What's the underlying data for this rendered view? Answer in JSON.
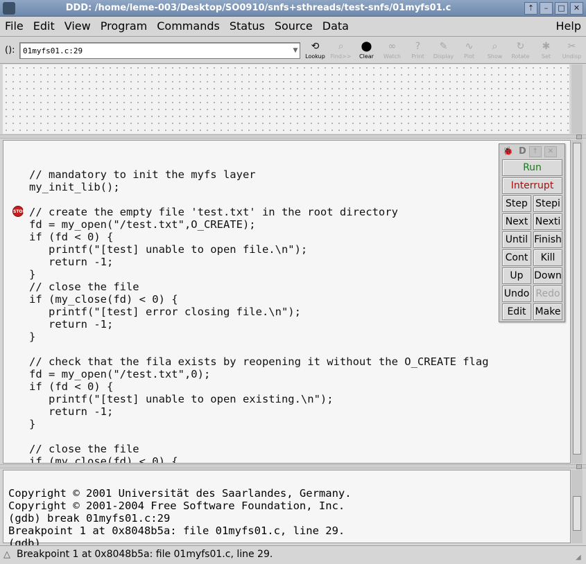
{
  "window": {
    "title": "DDD: /home/leme-003/Desktop/SO0910/snfs+sthreads/test-snfs/01myfs01.c",
    "buttons": [
      "⇡",
      "–",
      "□",
      "✕"
    ]
  },
  "menu": {
    "items": [
      "File",
      "Edit",
      "View",
      "Program",
      "Commands",
      "Status",
      "Source",
      "Data"
    ],
    "help": "Help"
  },
  "toolbar": {
    "arg_label": "():",
    "arg_value": "01myfs01.c:29",
    "tools": [
      {
        "label": "Lookup",
        "icon": "lookup-icon",
        "enabled": true
      },
      {
        "label": "Find>>",
        "icon": "find-icon",
        "enabled": false
      },
      {
        "label": "Clear",
        "icon": "clear-icon",
        "enabled": true
      },
      {
        "label": "Watch",
        "icon": "watch-icon",
        "enabled": false
      },
      {
        "label": "Print",
        "icon": "print-icon",
        "enabled": false
      },
      {
        "label": "Display",
        "icon": "display-icon",
        "enabled": false
      },
      {
        "label": "Plot",
        "icon": "plot-icon",
        "enabled": false
      },
      {
        "label": "Show",
        "icon": "show-icon",
        "enabled": false
      },
      {
        "label": "Rotate",
        "icon": "rotate-icon",
        "enabled": false
      },
      {
        "label": "Set",
        "icon": "set-icon",
        "enabled": false
      },
      {
        "label": "Undisp",
        "icon": "undisp-icon",
        "enabled": false
      }
    ]
  },
  "source": {
    "breakpoint_icon_text": "STOP",
    "lines": [
      "// mandatory to init the myfs layer",
      "my_init_lib();",
      "",
      "// create the empty file 'test.txt' in the root directory",
      "fd = my_open(\"/test.txt\",O_CREATE);",
      "if (fd < 0) {",
      "   printf(\"[test] unable to open file.\\n\");",
      "   return -1;",
      "}",
      "// close the file",
      "if (my_close(fd) < 0) {",
      "   printf(\"[test] error closing file.\\n\");",
      "   return -1;",
      "}",
      "",
      "// check that the fila exists by reopening it without the O_CREATE flag",
      "fd = my_open(\"/test.txt\",0);",
      "if (fd < 0) {",
      "   printf(\"[test] unable to open existing.\\n\");",
      "   return -1;",
      "}",
      "",
      "// close the file",
      "if (my_close(fd) < 0) {"
    ]
  },
  "command_tool": {
    "title": "D",
    "run": "Run",
    "interrupt": "Interrupt",
    "pairs": [
      [
        "Step",
        "Stepi"
      ],
      [
        "Next",
        "Nexti"
      ],
      [
        "Until",
        "Finish"
      ],
      [
        "Cont",
        "Kill"
      ],
      [
        "Up",
        "Down"
      ],
      [
        "Undo",
        "Redo"
      ],
      [
        "Edit",
        "Make"
      ]
    ]
  },
  "console": {
    "lines": [
      "Copyright © 2001 Universität des Saarlandes, Germany.",
      "Copyright © 2001-2004 Free Software Foundation, Inc.",
      "(gdb) break 01myfs01.c:29",
      "Breakpoint 1 at 0x8048b5a: file 01myfs01.c, line 29.",
      "(gdb)"
    ]
  },
  "status": {
    "text": "Breakpoint 1 at 0x8048b5a: file 01myfs01.c, line 29."
  }
}
